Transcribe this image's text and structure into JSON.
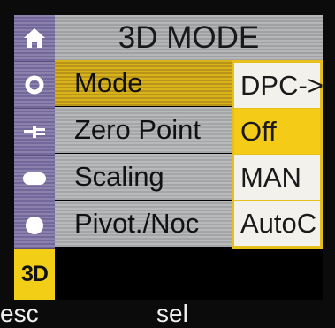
{
  "screen": {
    "title": "3D MODE",
    "sidebar": {
      "items": [
        {
          "icon": "home-icon",
          "label": ""
        },
        {
          "icon": "circle-icon",
          "label": ""
        },
        {
          "icon": "plug-icon",
          "label": ""
        },
        {
          "icon": "oval-icon",
          "label": ""
        },
        {
          "icon": "sphere-icon",
          "label": ""
        },
        {
          "icon": "",
          "label": "3D"
        }
      ],
      "active_index": 5
    },
    "menu": [
      {
        "label": "Mode",
        "selected": true
      },
      {
        "label": "Zero Point",
        "selected": false
      },
      {
        "label": "Scaling",
        "selected": false
      },
      {
        "label": "Pivot./Noc",
        "selected": false
      }
    ],
    "dropdown": {
      "options": [
        "DPC->",
        "Off",
        "MAN",
        "AutoC"
      ],
      "current": "Off"
    }
  },
  "softkeys": {
    "left": "esc",
    "center": "sel"
  },
  "colors": {
    "accent_yellow": "#f4cb16",
    "sidebar_purple": "#8c80ad",
    "menu_gray": "#b8b9bb",
    "dropdown_bg": "#f3f1ec"
  }
}
